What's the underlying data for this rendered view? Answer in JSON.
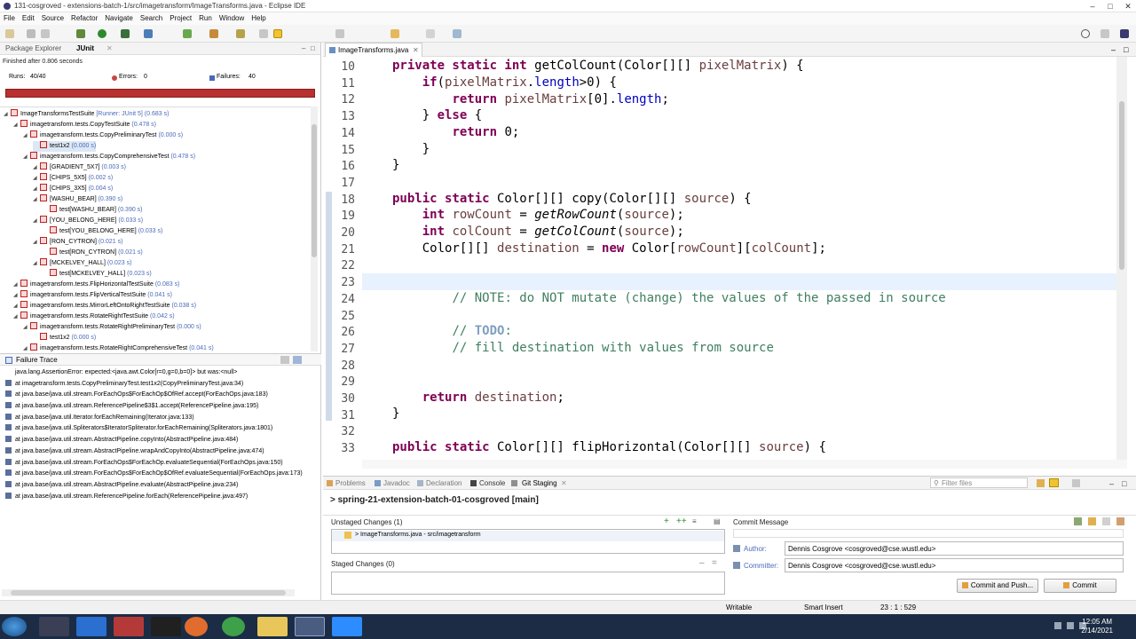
{
  "window": {
    "title": "131-cosgroved - extensions-batch-1/src/imagetransform/ImageTransforms.java - Eclipse IDE"
  },
  "menu": [
    "File",
    "Edit",
    "Source",
    "Refactor",
    "Navigate",
    "Search",
    "Project",
    "Run",
    "Window",
    "Help"
  ],
  "left_panel": {
    "tabs": [
      "Package Explorer",
      "JUnit"
    ],
    "finished": "Finished after 0.806 seconds",
    "runs_label": "Runs:",
    "runs_value": "40/40",
    "errors_label": "Errors:",
    "errors_value": "0",
    "failures_label": "Failures:",
    "failures_value": "40",
    "tree": [
      {
        "indent": 0,
        "label": "ImageTransformsTestSuite",
        "time": " [Runner: JUnit 5] (0.683 s)"
      },
      {
        "indent": 1,
        "label": "imagetransform.tests.CopyTestSuite",
        "time": " (0.478 s)"
      },
      {
        "indent": 2,
        "label": "imagetransform.tests.CopyPreliminaryTest",
        "time": " (0.000 s)"
      },
      {
        "indent": 3,
        "label": "test1x2",
        "time": " (0.000 s)",
        "selected": true
      },
      {
        "indent": 2,
        "label": "imagetransform.tests.CopyComprehensiveTest",
        "time": " (0.478 s)"
      },
      {
        "indent": 3,
        "label": "[GRADIENT_5X7]",
        "time": " (0.003 s)"
      },
      {
        "indent": 3,
        "label": "[CHIPS_5X5]",
        "time": " (0.002 s)"
      },
      {
        "indent": 3,
        "label": "[CHIPS_3X5]",
        "time": " (0.004 s)"
      },
      {
        "indent": 3,
        "label": "[WASHU_BEAR]",
        "time": " (0.390 s)"
      },
      {
        "indent": 4,
        "label": "test[WASHU_BEAR]",
        "time": " (0.390 s)"
      },
      {
        "indent": 3,
        "label": "[YOU_BELONG_HERE]",
        "time": " (0.033 s)"
      },
      {
        "indent": 4,
        "label": "test[YOU_BELONG_HERE]",
        "time": " (0.033 s)"
      },
      {
        "indent": 3,
        "label": "[RON_CYTRON]",
        "time": " (0.021 s)"
      },
      {
        "indent": 4,
        "label": "test[RON_CYTRON]",
        "time": " (0.021 s)"
      },
      {
        "indent": 3,
        "label": "[MCKELVEY_HALL]",
        "time": " (0.023 s)"
      },
      {
        "indent": 4,
        "label": "test[MCKELVEY_HALL]",
        "time": " (0.023 s)"
      },
      {
        "indent": 1,
        "label": "imagetransform.tests.FlipHorizontalTestSuite",
        "time": " (0.083 s)"
      },
      {
        "indent": 1,
        "label": "imagetransform.tests.FlipVerticalTestSuite",
        "time": " (0.041 s)"
      },
      {
        "indent": 1,
        "label": "imagetransform.tests.MirrorLeftOntoRightTestSuite",
        "time": " (0.038 s)"
      },
      {
        "indent": 1,
        "label": "imagetransform.tests.RotateRightTestSuite",
        "time": " (0.042 s)"
      },
      {
        "indent": 2,
        "label": "imagetransform.tests.RotateRightPreliminaryTest",
        "time": " (0.000 s)"
      },
      {
        "indent": 3,
        "label": "test1x2",
        "time": " (0.000 s)"
      },
      {
        "indent": 2,
        "label": "imagetransform.tests.RotateRightComprehensiveTest",
        "time": " (0.041 s)"
      }
    ],
    "failure_trace_title": "Failure Trace",
    "trace": [
      "java.lang.AssertionError: expected:<java.awt.Color[r=0,g=0,b=0]> but was:<null>",
      "at imagetransform.tests.CopyPreliminaryTest.test1x2(CopyPreliminaryTest.java:34)",
      "at java.base/java.util.stream.ForEachOps$ForEachOp$OfRef.accept(ForEachOps.java:183)",
      "at java.base/java.util.stream.ReferencePipeline$3$1.accept(ReferencePipeline.java:195)",
      "at java.base/java.util.Iterator.forEachRemaining(Iterator.java:133)",
      "at java.base/java.util.Spliterators$IteratorSpliterator.forEachRemaining(Spliterators.java:1801)",
      "at java.base/java.util.stream.AbstractPipeline.copyInto(AbstractPipeline.java:484)",
      "at java.base/java.util.stream.AbstractPipeline.wrapAndCopyInto(AbstractPipeline.java:474)",
      "at java.base/java.util.stream.ForEachOps$ForEachOp.evaluateSequential(ForEachOps.java:150)",
      "at java.base/java.util.stream.ForEachOps$ForEachOp$OfRef.evaluateSequential(ForEachOps.java:173)",
      "at java.base/java.util.stream.AbstractPipeline.evaluate(AbstractPipeline.java:234)",
      "at java.base/java.util.stream.ReferencePipeline.forEach(ReferencePipeline.java:497)"
    ]
  },
  "editor": {
    "tab": "ImageTransforms.java",
    "line_numbers": [
      "10",
      "11",
      "12",
      "13",
      "14",
      "15",
      "16",
      "17",
      "18",
      "19",
      "20",
      "21",
      "22",
      "23",
      "24",
      "25",
      "26",
      "27",
      "28",
      "29",
      "30",
      "31",
      "32",
      "33"
    ]
  },
  "bottom": {
    "tabs": [
      "Problems",
      "Javadoc",
      "Declaration",
      "Console",
      "Git Staging"
    ],
    "filter_placeholder": "Filter files",
    "repo": "spring-21-extension-batch-01-cosgroved [main]",
    "unstaged_label": "Unstaged Changes (1)",
    "unstaged_file": "ImageTransforms.java - src/imagetransform",
    "staged_label": "Staged Changes (0)",
    "commit_message_label": "Commit Message",
    "author_label": "Author:",
    "author_value": "Dennis Cosgrove <cosgroved@cse.wustl.edu>",
    "committer_label": "Committer:",
    "committer_value": "Dennis Cosgrove <cosgroved@cse.wustl.edu>",
    "commit_push_label": "Commit and Push...",
    "commit_label": "Commit"
  },
  "status": {
    "mode": "Writable",
    "insert": "Smart Insert",
    "position": "23 : 1 : 529"
  },
  "taskbar": {
    "time": "12:05 AM",
    "date": "2/14/2021"
  }
}
